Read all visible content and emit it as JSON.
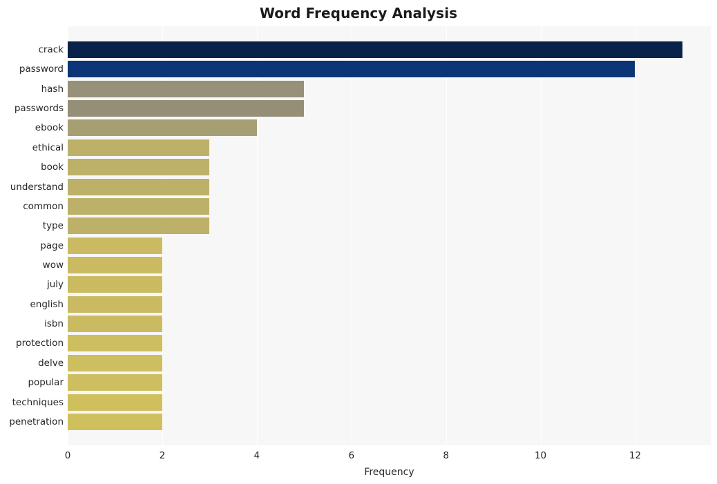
{
  "chart_data": {
    "type": "bar",
    "orientation": "horizontal",
    "title": "Word Frequency Analysis",
    "xlabel": "Frequency",
    "ylabel": "",
    "xlim": [
      0,
      13.6
    ],
    "xticks": [
      0,
      2,
      4,
      6,
      8,
      10,
      12
    ],
    "xticklabels": [
      "0",
      "2",
      "4",
      "6",
      "8",
      "10",
      "12"
    ],
    "grid": "vertical-white",
    "legend": "none",
    "background": "#f7f7f7",
    "categories": [
      "crack",
      "password",
      "hash",
      "passwords",
      "ebook",
      "ethical",
      "book",
      "understand",
      "common",
      "type",
      "page",
      "wow",
      "july",
      "english",
      "isbn",
      "protection",
      "delve",
      "popular",
      "techniques",
      "penetration"
    ],
    "values": [
      13,
      12,
      5,
      5,
      4,
      3,
      3,
      3,
      3,
      3,
      2,
      2,
      2,
      2,
      2,
      2,
      2,
      2,
      2,
      2
    ],
    "bar_colors": [
      "#08224a",
      "#0b3576",
      "#979179",
      "#958f78",
      "#a79f74",
      "#bdb068",
      "#bdb068",
      "#bdb068",
      "#bdb068",
      "#bdb068",
      "#cabb62",
      "#cabb62",
      "#cabb62",
      "#cabb62",
      "#cabb62",
      "#cdbe60",
      "#cdbe60",
      "#cdbe60",
      "#d0c05d",
      "#d0c05d"
    ]
  },
  "colors": {
    "title_text": "#1a1a1a",
    "tick_text": "#262626",
    "plot_background": "#f7f7f7",
    "gridline": "#ffffff",
    "figure_background": "#ffffff"
  }
}
